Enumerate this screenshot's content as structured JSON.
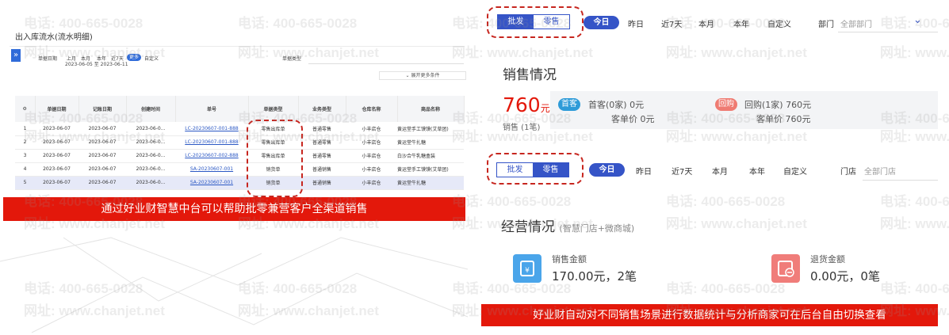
{
  "left": {
    "title": "出入库流水(流水明细)",
    "filter": {
      "date_label": "单据日期",
      "options": [
        "上月",
        "本月",
        "本年",
        "近7天"
      ],
      "more": "更多",
      "custom": "自定义",
      "range": "2023-06-05 至 2023-06-11",
      "type_label": "单据类型",
      "expand": "展开更多条件"
    },
    "table": {
      "headers": [
        "单据日期",
        "记账日期",
        "创建时间",
        "单号",
        "单据类型",
        "业务类型",
        "仓库名称",
        "商品名称"
      ],
      "rows": [
        [
          "1",
          "2023-06-07",
          "2023-06-07",
          "2023-06-0...",
          "LC-20230607-001-888",
          "零售出库单",
          "普通零售",
          "小丰店仓",
          "黄运堂手工馍馍(艾草团)"
        ],
        [
          "2",
          "2023-06-07",
          "2023-06-07",
          "2023-06-0...",
          "LC-20230607-001-888",
          "零售出库单",
          "普通零售",
          "小丰店仓",
          "黄运堂牛扎糖"
        ],
        [
          "3",
          "2023-06-07",
          "2023-06-07",
          "2023-06-0...",
          "LC-20230607-002-888",
          "零售出库单",
          "普通零售",
          "小丰店仓",
          "白沙合牛乳糖盒装"
        ],
        [
          "4",
          "2023-06-07",
          "2023-06-07",
          "2023-06-0...",
          "SA-20230607-001",
          "销货单",
          "普通销售",
          "小丰店仓",
          "黄运堂手工馍馍(艾草团)"
        ],
        [
          "5",
          "2023-06-07",
          "2023-06-07",
          "2023-06-0...",
          "SA-20230607-001",
          "销货单",
          "普通销售",
          "小丰店仓",
          "黄运堂牛扎糖"
        ]
      ]
    },
    "caption": "通过好业财智慧中台可以帮助批零兼营客户全渠道销售"
  },
  "right": {
    "top_tabs": [
      "批发",
      "零售"
    ],
    "top_active": "批发",
    "top_filters": [
      "今日",
      "昨日",
      "近7天",
      "本月",
      "本年",
      "自定义"
    ],
    "dept_label": "部门",
    "dept_value": "全部部门",
    "sales": {
      "heading": "销售情况",
      "amount": "760",
      "amount_unit": "元",
      "count": "销售 (1笔)",
      "first_badge": "首客",
      "first_line": "首客(0家) 0元",
      "first_price": "客单价 0元",
      "repeat_badge": "回购",
      "repeat_line": "回购(1家) 760元",
      "repeat_price": "客单价 760元"
    },
    "mid_tabs": [
      "批发",
      "零售"
    ],
    "mid_active": "零售",
    "mid_filters": [
      "今日",
      "昨日",
      "近7天",
      "本月",
      "本年",
      "自定义"
    ],
    "store_label": "门店",
    "store_value": "全部门店",
    "ops": {
      "heading": "经营情况",
      "sub": "(智慧门店+微商城)",
      "sales_label": "销售金额",
      "sales_value": "170.00元，2笔",
      "refund_label": "退货金额",
      "refund_value": "0.00元，0笔"
    },
    "caption": "好业财自动对不同销售场景进行数据统计与分析商家可在后台自由切换查看"
  },
  "watermarks": [
    "电话: 400-665-0028",
    "网址: www.chanjet.net"
  ],
  "colors": {
    "accent": "#3554c7",
    "red": "#e3180b",
    "dash": "#c7261f"
  }
}
